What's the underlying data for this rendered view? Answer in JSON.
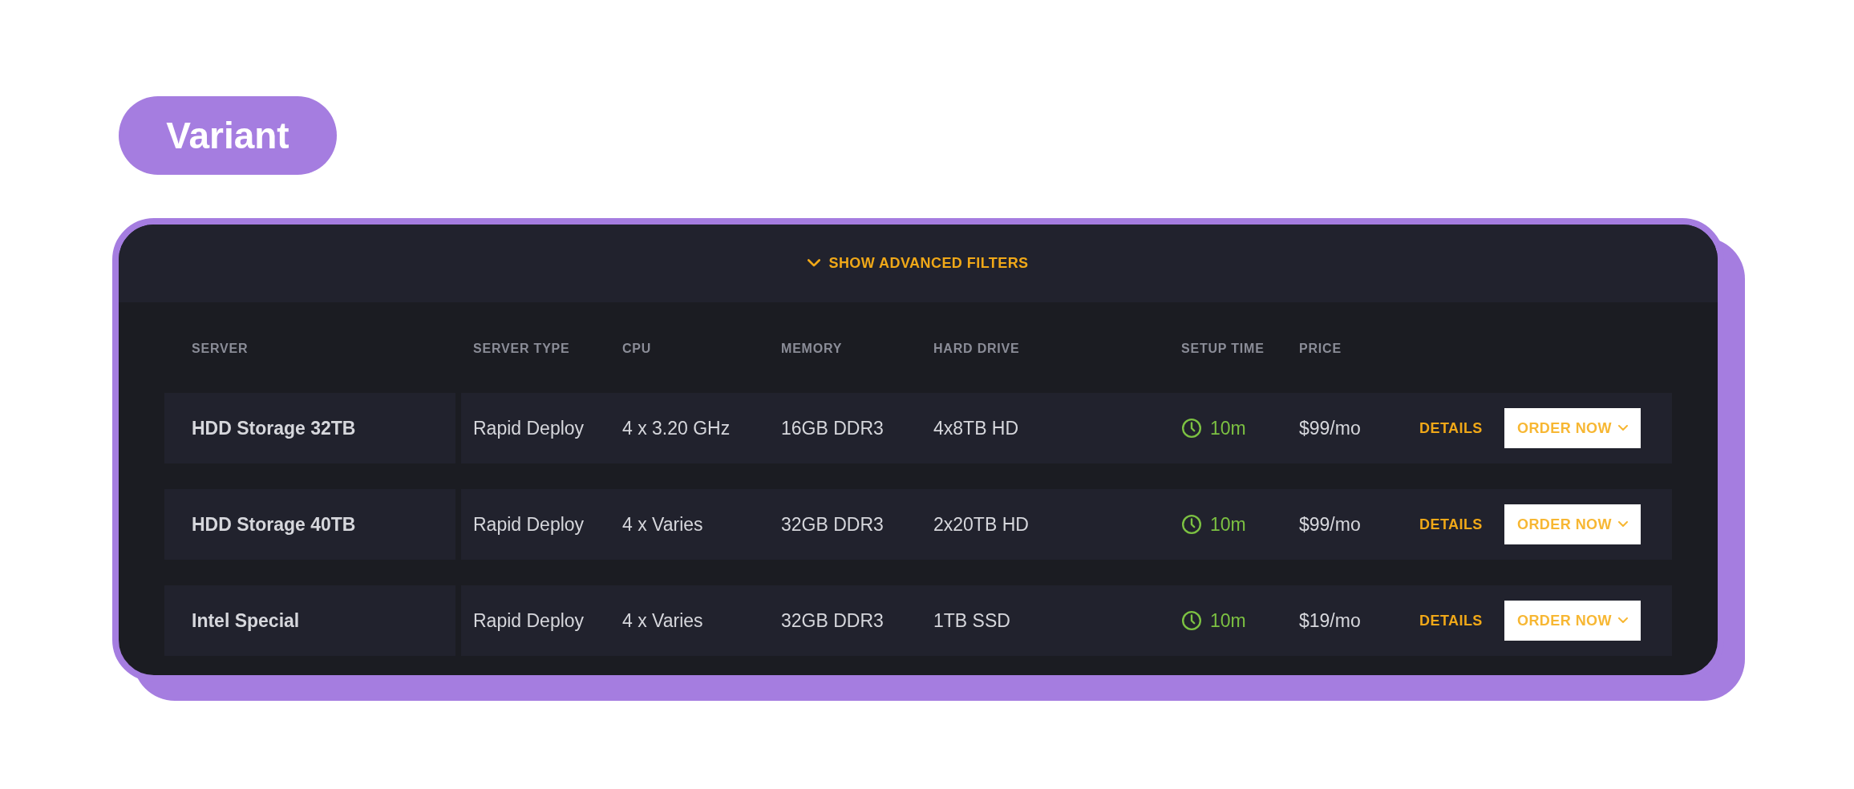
{
  "badge": {
    "label": "Variant"
  },
  "filters_toggle": {
    "label": "SHOW ADVANCED FILTERS",
    "expanded": false
  },
  "table": {
    "columns": [
      "SERVER",
      "SERVER TYPE",
      "CPU",
      "MEMORY",
      "HARD DRIVE",
      "SETUP TIME",
      "PRICE"
    ],
    "rows": [
      {
        "server": "HDD Storage 32TB",
        "server_type": "Rapid Deploy",
        "cpu": "4 x 3.20 GHz",
        "memory": "16GB DDR3",
        "hard_drive": "4x8TB HD",
        "setup_time": "10m",
        "price": "$99/mo",
        "details": "DETAILS",
        "order": "ORDER NOW"
      },
      {
        "server": "HDD Storage 40TB",
        "server_type": "Rapid Deploy",
        "cpu": "4 x Varies",
        "memory": "32GB DDR3",
        "hard_drive": "2x20TB HD",
        "setup_time": "10m",
        "price": "$99/mo",
        "details": "DETAILS",
        "order": "ORDER NOW"
      },
      {
        "server": "Intel Special",
        "server_type": "Rapid Deploy",
        "cpu": "4 x Varies",
        "memory": "32GB DDR3",
        "hard_drive": "1TB SSD",
        "setup_time": "10m",
        "price": "$19/mo",
        "details": "DETAILS",
        "order": "ORDER NOW"
      }
    ]
  }
}
